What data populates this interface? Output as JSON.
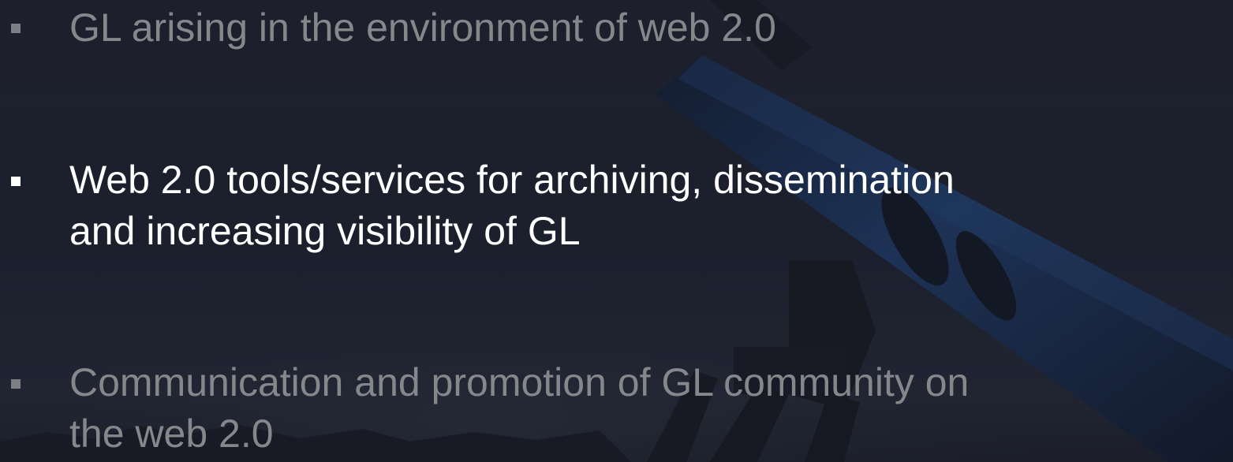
{
  "slide": {
    "bullets": [
      {
        "text": "GL arising in the environment of web 2.0",
        "state": "dimmed"
      },
      {
        "line1": "Web 2.0 tools/services for archiving, dissemination",
        "line2": "and increasing visibility of GL",
        "state": "highlighted"
      },
      {
        "line1": "Communication and promotion of GL community on",
        "line2": "the web 2.0",
        "state": "dimmed"
      }
    ]
  },
  "colors": {
    "background": "#1c2130",
    "highlighted_text": "#ffffff",
    "dimmed_text": "#85878b",
    "telescope_tube": "#1f4a8a"
  }
}
